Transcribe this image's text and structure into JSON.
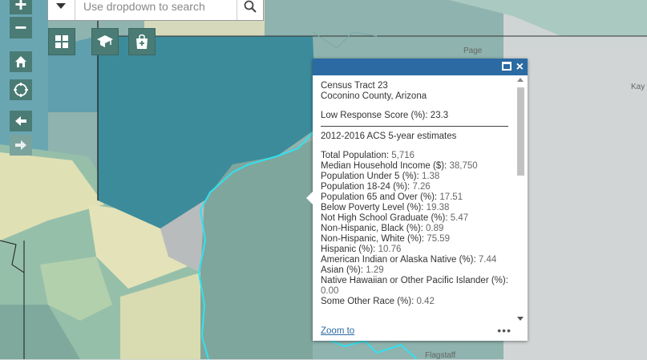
{
  "search": {
    "placeholder": "Use dropdown to search"
  },
  "map_labels": {
    "page": "Page",
    "kayenta": "Kay",
    "flagstaff": "Flagstaff"
  },
  "popup": {
    "title": "Census Tract 23",
    "subtitle": "Coconino County, Arizona",
    "score_label": "Low Response Score (%):",
    "score_value": "23.3",
    "section": "2012-2016 ACS 5-year estimates",
    "fields": [
      {
        "label": "Total Population:",
        "value": "5,716"
      },
      {
        "label": "Median Household Income ($):",
        "value": "38,750"
      },
      {
        "label": "Population Under 5 (%):",
        "value": "1.38"
      },
      {
        "label": "Population 18-24 (%):",
        "value": "7.26"
      },
      {
        "label": "Population 65 and Over (%):",
        "value": "17.51"
      },
      {
        "label": "Below Poverty Level (%):",
        "value": "19.38"
      },
      {
        "label": "Not High School Graduate (%):",
        "value": "5.47"
      },
      {
        "label": "Non-Hispanic, Black (%):",
        "value": "0.89"
      },
      {
        "label": "Non-Hispanic, White (%):",
        "value": "75.59"
      },
      {
        "label": "Hispanic (%):",
        "value": "10.76"
      },
      {
        "label": "American Indian or Alaska Native (%):",
        "value": "7.44"
      },
      {
        "label": "Asian (%):",
        "value": "1.29"
      },
      {
        "label": "Native Hawaiian or Other Pacific Islander (%):",
        "value": "0.00"
      },
      {
        "label": "Some Other Race (%):",
        "value": "0.42"
      }
    ],
    "zoom_to": "Zoom to",
    "more": "•••"
  },
  "colors": {
    "accent": "#4a7b75",
    "popup_header": "#2b6aa3",
    "tract_outline": "#33e0f0"
  }
}
